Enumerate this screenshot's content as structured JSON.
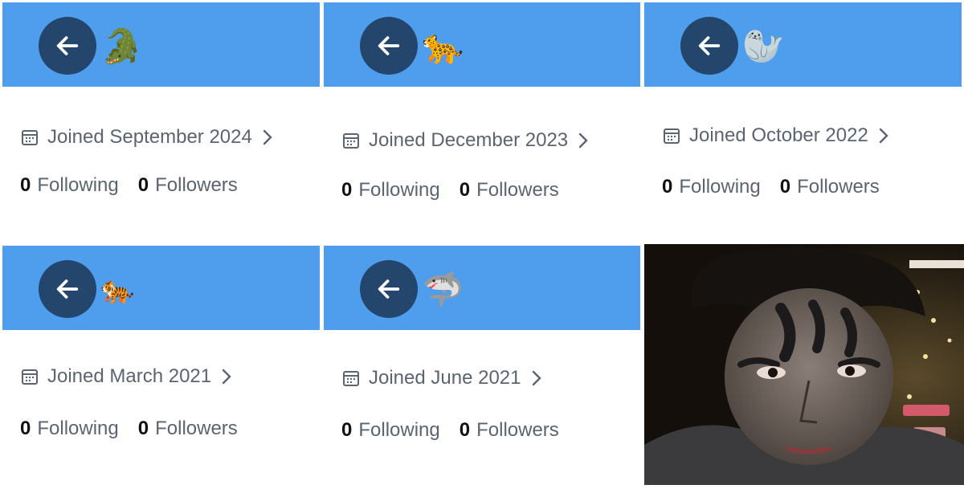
{
  "theme": {
    "banner_color": "#4f9ded",
    "button_color": "#24456c"
  },
  "profiles": [
    {
      "emoji": "🐊",
      "joined": "Joined September 2024",
      "following_count": "0",
      "following_label": "Following",
      "followers_count": "0",
      "followers_label": "Followers"
    },
    {
      "emoji": "🐆",
      "joined": "Joined December 2023",
      "following_count": "0",
      "following_label": "Following",
      "followers_count": "0",
      "followers_label": "Followers"
    },
    {
      "emoji": "🦭",
      "joined": "Joined October 2022",
      "following_count": "0",
      "following_label": "Following",
      "followers_count": "0",
      "followers_label": "Followers"
    },
    {
      "emoji": "🐅",
      "joined": "Joined March 2021",
      "following_count": "0",
      "following_label": "Following",
      "followers_count": "0",
      "followers_label": "Followers"
    },
    {
      "emoji": "🦈",
      "joined": "Joined June 2021",
      "following_count": "0",
      "following_label": "Following",
      "followers_count": "0",
      "followers_label": "Followers"
    }
  ],
  "photo": {
    "description_icon": "face-paint-photo"
  }
}
